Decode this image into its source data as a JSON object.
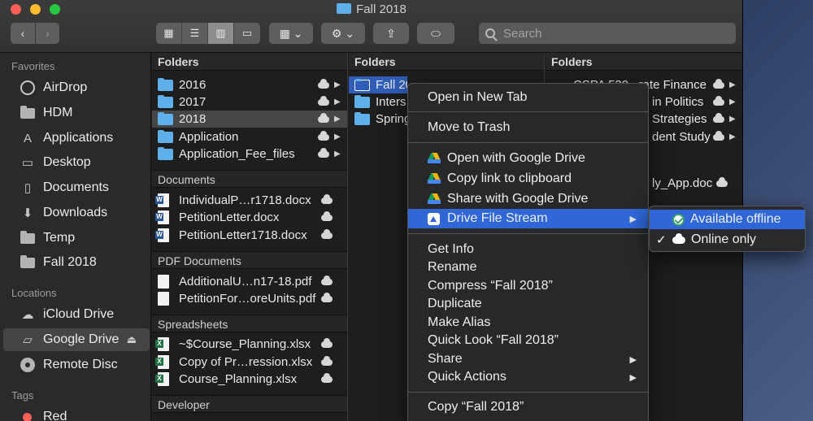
{
  "window": {
    "title": "Fall 2018"
  },
  "toolbar": {
    "back_icon": "‹",
    "forward_icon": "›",
    "view_icons": [
      "▦",
      "☰",
      "▥",
      "▭"
    ],
    "group_icon": "▦ ⌄",
    "action_icon": "⚙ ⌄",
    "share_icon": "⇪",
    "tag_icon": "⬭",
    "search_placeholder": "Search"
  },
  "sidebar": {
    "favorites_heading": "Favorites",
    "favorites": [
      {
        "label": "AirDrop",
        "icon": "airdrop-icon"
      },
      {
        "label": "HDM",
        "icon": "folder-icon"
      },
      {
        "label": "Applications",
        "icon": "applications-icon"
      },
      {
        "label": "Desktop",
        "icon": "desktop-icon"
      },
      {
        "label": "Documents",
        "icon": "documents-icon"
      },
      {
        "label": "Downloads",
        "icon": "downloads-icon"
      },
      {
        "label": "Temp",
        "icon": "folder-icon"
      },
      {
        "label": "Fall 2018",
        "icon": "folder-icon"
      }
    ],
    "locations_heading": "Locations",
    "locations": [
      {
        "label": "iCloud Drive",
        "icon": "icloud-icon"
      },
      {
        "label": "Google Drive",
        "icon": "google-drive-icon",
        "eject": "⏏"
      },
      {
        "label": "Remote Disc",
        "icon": "disc-icon"
      }
    ],
    "tags_heading": "Tags",
    "tags": [
      {
        "label": "Red",
        "color": "#ff5f56"
      }
    ]
  },
  "col1": {
    "sections": [
      {
        "heading": "Folders",
        "items": [
          "2016",
          "2017",
          "2018",
          "Application",
          "Application_Fee_files"
        ]
      },
      {
        "heading": "Documents",
        "items": [
          "IndividualP…r1718.docx",
          "PetitionLetter.docx",
          "PetitionLetter1718.docx"
        ]
      },
      {
        "heading": "PDF Documents",
        "items": [
          "AdditionalU…n17-18.pdf",
          "PetitionFor…oreUnits.pdf"
        ]
      },
      {
        "heading": "Spreadsheets",
        "items": [
          "~$Course_Planning.xlsx",
          "Copy of Pr…ression.xlsx",
          "Course_Planning.xlsx"
        ]
      },
      {
        "heading": "Developer",
        "items": []
      }
    ]
  },
  "col2": {
    "heading": "Folders",
    "items": [
      "Fall 2018",
      "Inters",
      "Spring"
    ]
  },
  "col3": {
    "heading": "Folders",
    "items": [
      "CSPA 530 _rate Finance",
      "in Politics",
      "Strategies",
      "dent Study",
      "ly_App.doc"
    ]
  },
  "context_menu": {
    "items": [
      "Open in New Tab",
      "Move to Trash",
      "Open with Google Drive",
      "Copy link to clipboard",
      "Share with Google Drive",
      "Drive File Stream",
      "Get Info",
      "Rename",
      "Compress “Fall 2018”",
      "Duplicate",
      "Make Alias",
      "Quick Look “Fall 2018”",
      "Share",
      "Quick Actions",
      "Copy “Fall 2018”"
    ],
    "submenu_arrow": "▶"
  },
  "submenu": {
    "items": [
      "Available offline",
      "Online only"
    ],
    "check": "✓"
  },
  "colors": {
    "accent": "#2f67d7",
    "folder": "#5fb0ea"
  }
}
